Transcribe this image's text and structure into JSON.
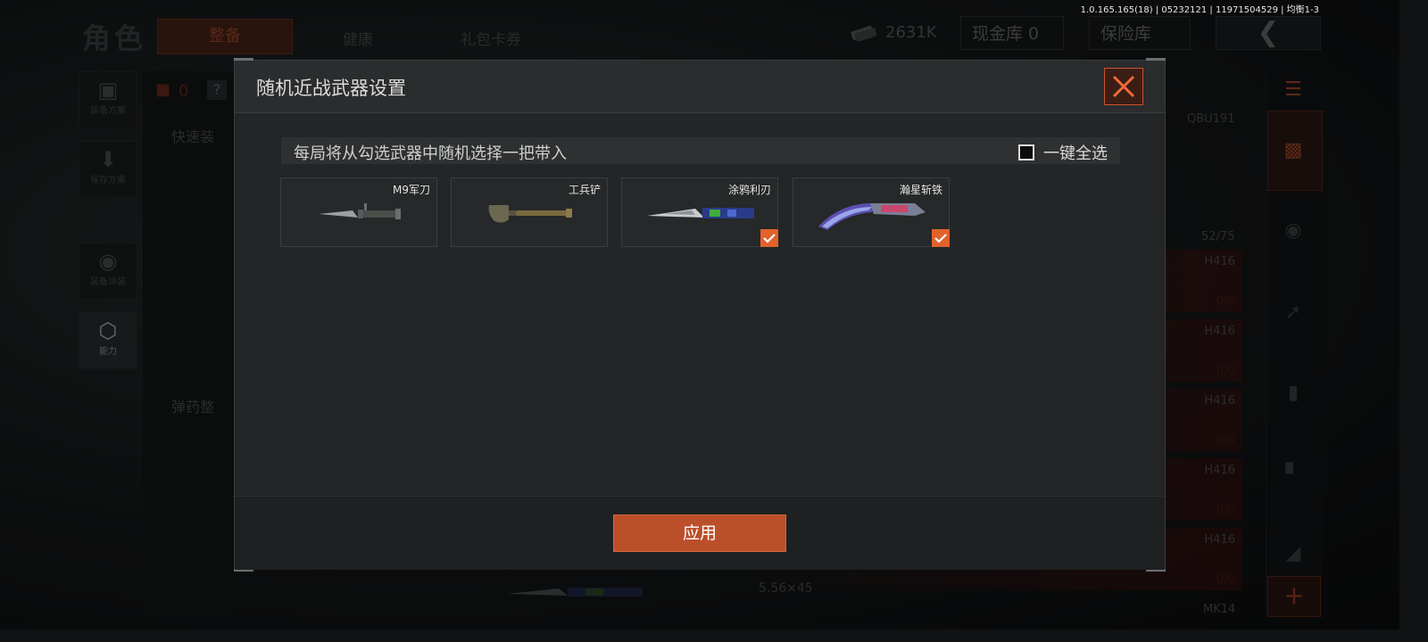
{
  "version": "1.0.165.165(18) | 05232121 | 11971504529 | 均衡1-3",
  "header": {
    "title": "角色",
    "tabs": [
      {
        "label": "整备",
        "active": true
      },
      {
        "label": "健康",
        "active": false
      },
      {
        "label": "礼包卡券",
        "active": false
      }
    ],
    "money": "2631K",
    "cash_storage": "现金库 0",
    "insurance": "保险库"
  },
  "sidebar": [
    {
      "label": "装备方案",
      "icon": "backpack-icon"
    },
    {
      "label": "保存方案",
      "icon": "download-icon"
    },
    {
      "label": "装备涂装",
      "icon": "helmet-icon"
    },
    {
      "label": "能力",
      "icon": "lightning-shield-icon"
    }
  ],
  "left_panel": {
    "counter": "0",
    "help": "?",
    "quick_label": "快速装",
    "ammo_label": "弹药整"
  },
  "right_list": {
    "weapon_name": "QBU191",
    "ammo_count": "52/75",
    "rows": [
      {
        "label": "H416",
        "count": "0/0"
      },
      {
        "label": "H416",
        "count": "0/0"
      },
      {
        "label": "H416",
        "count": "0/0"
      },
      {
        "label": "H416",
        "count": "0/0"
      },
      {
        "label": "H416",
        "count": "0/0"
      }
    ],
    "caliber": "5.56×45",
    "last_label": "MK14"
  },
  "modal": {
    "title": "随机近战武器设置",
    "hint": "每局将从勾选武器中随机选择一把带入",
    "select_all_label": "一键全选",
    "select_all_checked": false,
    "weapons": [
      {
        "name": "M9军刀",
        "checked": false
      },
      {
        "name": "工兵铲",
        "checked": false
      },
      {
        "name": "涂鸦利刃",
        "checked": true
      },
      {
        "name": "瀚星斩铁",
        "checked": true
      }
    ],
    "apply_label": "应用"
  },
  "colors": {
    "accent": "#e2612d",
    "apply_button": "#bb4f2a",
    "modal_bg": "#232526"
  }
}
